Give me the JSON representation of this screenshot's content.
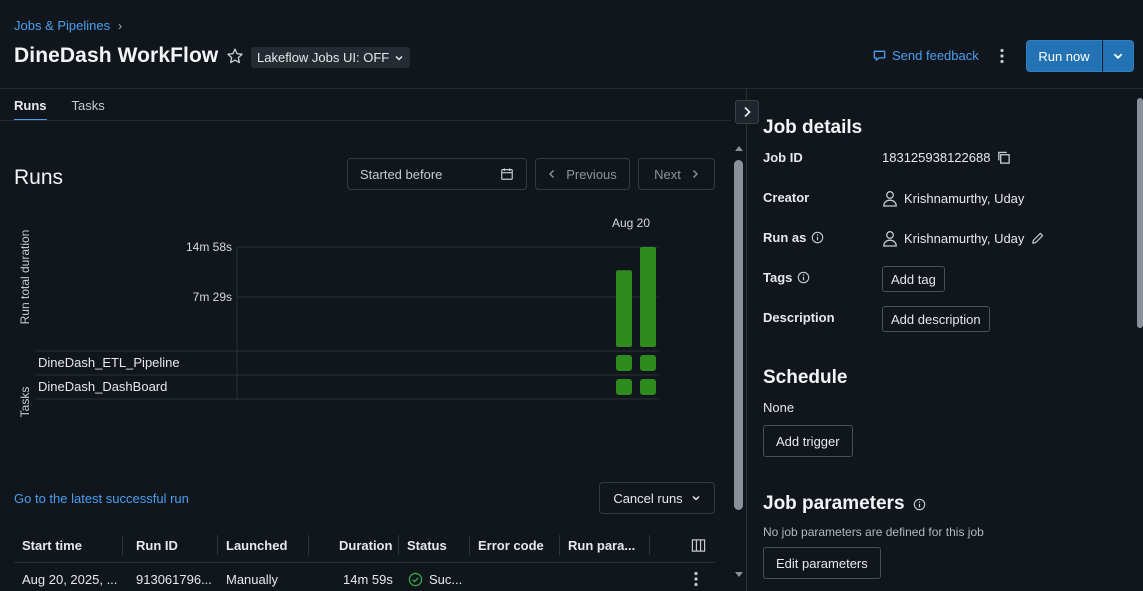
{
  "header": {
    "breadcrumb": "Jobs & Pipelines",
    "title": "DineDash WorkFlow",
    "lakeflow_toggle": "Lakeflow Jobs UI: OFF",
    "send_feedback": "Send feedback",
    "run_now": "Run now"
  },
  "tabs": [
    {
      "label": "Runs",
      "active": true
    },
    {
      "label": "Tasks",
      "active": false
    }
  ],
  "runs": {
    "heading": "Runs",
    "started_before_placeholder": "Started before",
    "previous": "Previous",
    "next": "Next",
    "latest_link": "Go to the latest successful run",
    "cancel_runs": "Cancel runs"
  },
  "chart_data": {
    "type": "bar",
    "date_label": "Aug 20",
    "ylabel": "Run total duration",
    "y_ticks": [
      "14m 58s",
      "7m 29s"
    ],
    "y_tick_values_seconds": [
      898,
      449
    ],
    "series": [
      {
        "values_seconds": [
          689,
          898
        ]
      }
    ],
    "tasks_label": "Tasks",
    "tasks": [
      "DineDash_ETL_Pipeline",
      "DineDash_DashBoard"
    ],
    "task_status": "success",
    "colors": {
      "success": "#2e8b1e"
    }
  },
  "table": {
    "columns": [
      "Start time",
      "Run ID",
      "Launched",
      "Duration",
      "Status",
      "Error code",
      "Run para..."
    ],
    "rows": [
      {
        "start_time": "Aug 20, 2025, ...",
        "run_id": "913061796...",
        "launched": "Manually",
        "duration": "14m 59s",
        "status": "Suc...",
        "error_code": ""
      }
    ]
  },
  "job_details": {
    "heading": "Job details",
    "job_id_label": "Job ID",
    "job_id": "183125938122688",
    "creator_label": "Creator",
    "creator": "Krishnamurthy, Uday",
    "run_as_label": "Run as",
    "run_as": "Krishnamurthy, Uday",
    "tags_label": "Tags",
    "add_tag": "Add tag",
    "description_label": "Description",
    "add_description": "Add description"
  },
  "schedule": {
    "heading": "Schedule",
    "value": "None",
    "add_trigger": "Add trigger"
  },
  "job_parameters": {
    "heading": "Job parameters",
    "empty_text": "No job parameters are defined for this job",
    "edit_parameters": "Edit parameters"
  },
  "colors": {
    "accent": "#4a9ff0",
    "primary_button": "#2272b4",
    "success": "#2e8b1e",
    "background": "#11161c"
  },
  "icons": [
    "chevron-right-icon",
    "star-icon",
    "chevron-down-icon",
    "feedback-icon",
    "kebab-icon",
    "calendar-icon",
    "chevron-left-icon",
    "copy-icon",
    "user-icon",
    "info-icon",
    "pencil-icon",
    "check-circle-icon",
    "columns-icon"
  ]
}
